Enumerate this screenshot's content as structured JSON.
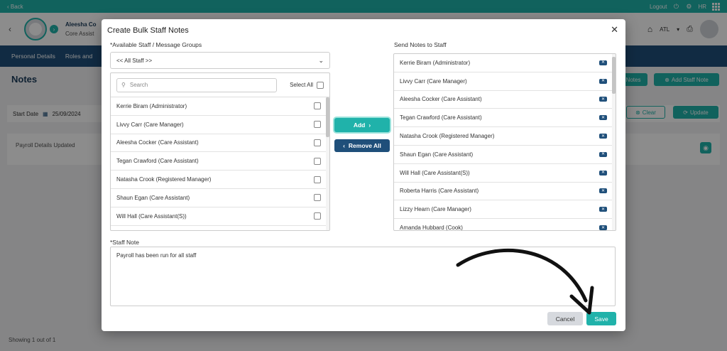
{
  "topbar": {
    "back_label": "‹ Back",
    "logout_label": "Logout",
    "hr_label": "HR"
  },
  "header": {
    "staff_name": "Aleesha Co",
    "staff_role": "Core Assist",
    "location_label": "ATL"
  },
  "tabs": [
    {
      "label": "Personal Details"
    },
    {
      "label": "Roles and"
    }
  ],
  "page": {
    "title": "Notes",
    "notes_button": "Notes",
    "add_staff_note_button": "Add Staff Note",
    "start_date_label": "Start Date",
    "start_date_value": "25/09/2024",
    "clear_button": "Clear",
    "update_button": "Update",
    "note_entry": "Payroll Details Updated",
    "showing_text": "Showing 1 out of 1"
  },
  "modal": {
    "title": "Create Bulk Staff Notes",
    "available_label": "*Available Staff / Message Groups",
    "group_select_value": "<< All Staff >>",
    "search_placeholder": "Search",
    "select_all_label": "Select All",
    "send_label": "Send Notes to Staff",
    "add_button": "Add",
    "remove_all_button": "Remove All",
    "staff_note_label": "*Staff Note",
    "staff_note_text": "Payroll has been run for all staff",
    "cancel_button": "Cancel",
    "save_button": "Save",
    "available_staff": [
      {
        "name": "Kerrie Biram (Administrator)"
      },
      {
        "name": "Livvy Carr (Care Manager)"
      },
      {
        "name": "Aleesha Cocker (Care Assistant)"
      },
      {
        "name": "Tegan Crawford (Care Assistant)"
      },
      {
        "name": "Natasha Crook (Registered Manager)"
      },
      {
        "name": "Shaun Egan (Care Assistant)"
      },
      {
        "name": "Will Hall (Care Assistant(S))"
      }
    ],
    "selected_staff": [
      {
        "name": "Kerrie Biram (Administrator)"
      },
      {
        "name": "Livvy Carr (Care Manager)"
      },
      {
        "name": "Aleesha Cocker (Care Assistant)"
      },
      {
        "name": "Tegan Crawford (Care Assistant)"
      },
      {
        "name": "Natasha Crook (Registered Manager)"
      },
      {
        "name": "Shaun Egan (Care Assistant)"
      },
      {
        "name": "Will Hall (Care Assistant(S))"
      },
      {
        "name": "Roberta Harris (Care Assistant)"
      },
      {
        "name": "Lizzy Hearn (Care Manager)"
      },
      {
        "name": "Amanda Hubbard (Cook)"
      }
    ]
  },
  "colors": {
    "accent": "#20b2aa",
    "navy": "#1f4f7a",
    "annotation_arrow": "#111111"
  },
  "icons": [
    "calendar-icon",
    "search-icon",
    "chevron-down-icon",
    "close-icon",
    "remove-tag-icon",
    "printer-icon",
    "home-icon",
    "grid-icon",
    "gear-icon",
    "eye-icon"
  ]
}
